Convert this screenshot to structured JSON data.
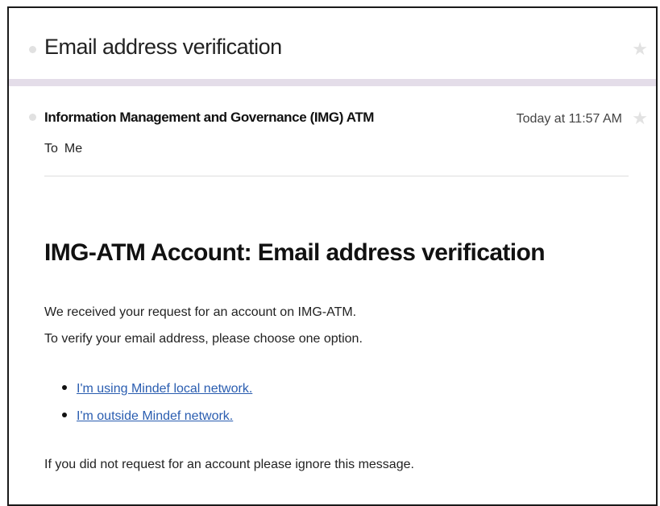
{
  "subject": {
    "title": "Email address verification"
  },
  "message_header": {
    "sender": "Information Management and Governance (IMG) ATM",
    "time": "Today at 11:57 AM",
    "to_label": "To",
    "to_value": "Me"
  },
  "body": {
    "heading": "IMG-ATM Account: Email address verification",
    "paragraph_1": "We received your request for an account on IMG-ATM.",
    "paragraph_2": "To verify your email address, please choose one option.",
    "options": [
      {
        "label": "I'm using Mindef local network."
      },
      {
        "label": "I'm outside Mindef network."
      }
    ],
    "footer_text": "If you did not request for an account please ignore this message."
  },
  "icons": {
    "unread_dot": "circle-dot-icon",
    "star": "star-icon"
  },
  "colors": {
    "link": "#2a5db0",
    "band": "#e4dde9",
    "star": "#e2e2e2"
  }
}
